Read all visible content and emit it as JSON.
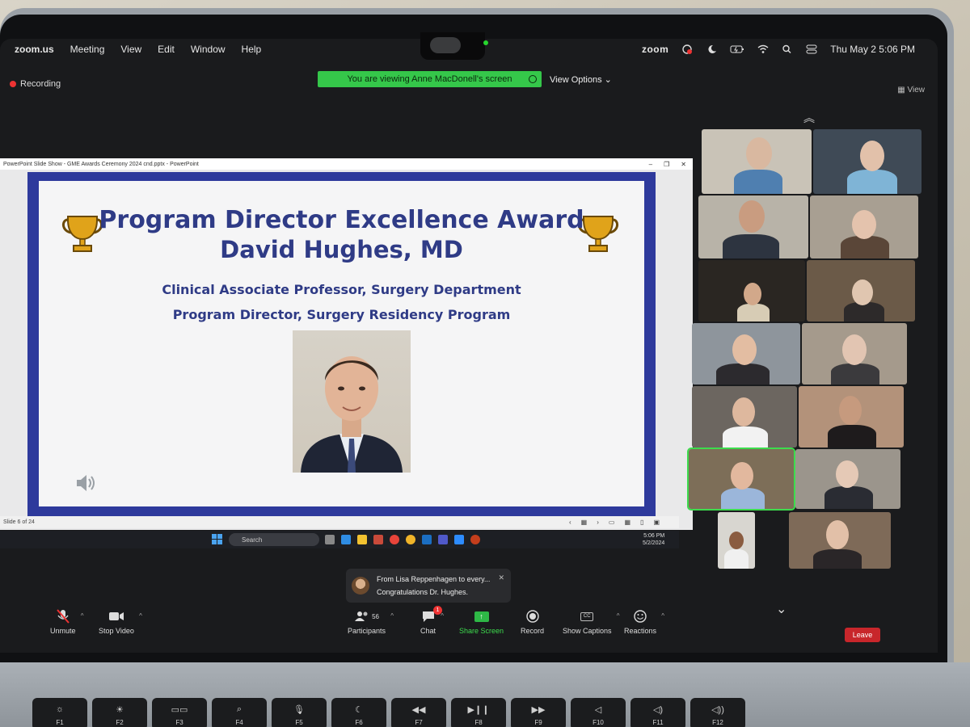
{
  "menubar": {
    "app_name": "zoom.us",
    "items": [
      "Meeting",
      "View",
      "Edit",
      "Window",
      "Help"
    ],
    "brand": "zoom",
    "datetime": "Thu May 2  5:06 PM"
  },
  "recording_label": "Recording",
  "share_banner": "You are viewing Anne MacDonell's screen",
  "view_options_label": "View Options",
  "view_label": "View",
  "ppt": {
    "window_title": "PowerPoint Slide Show  -  GME Awards Ceremony 2024 cnd.pptx - PowerPoint",
    "slide_title": "Program Director Excellence Award",
    "slide_name": "David Hughes, MD",
    "slide_sub1": "Clinical Associate Professor, Surgery Department",
    "slide_sub2": "Program Director, Surgery Residency Program",
    "status_slide": "Slide 6 of 24"
  },
  "taskbar": {
    "search_placeholder": "Search",
    "time": "5:06 PM",
    "date": "5/2/2024"
  },
  "chat_toast": {
    "from": "From Lisa Reppenhagen to every...",
    "message": "Congratulations Dr. Hughes."
  },
  "toolbar": {
    "unmute": "Unmute",
    "stop_video": "Stop Video",
    "participants": "Participants",
    "participants_count": "56",
    "chat": "Chat",
    "chat_badge": "1",
    "share_screen": "Share Screen",
    "record": "Record",
    "show_captions": "Show Captions",
    "captions_icon": "CC",
    "reactions": "Reactions",
    "leave": "Leave"
  },
  "keyboard": {
    "keys": [
      {
        "sym": "☼",
        "fn": "F1"
      },
      {
        "sym": "☀",
        "fn": "F2"
      },
      {
        "sym": "▭▭",
        "fn": "F3"
      },
      {
        "sym": "⌕",
        "fn": "F4"
      },
      {
        "sym": "🎙",
        "fn": "F5"
      },
      {
        "sym": "☾",
        "fn": "F6"
      },
      {
        "sym": "◀◀",
        "fn": "F7"
      },
      {
        "sym": "▶❙❙",
        "fn": "F8"
      },
      {
        "sym": "▶▶",
        "fn": "F9"
      },
      {
        "sym": "◁",
        "fn": "F10"
      },
      {
        "sym": "◁)",
        "fn": "F11"
      },
      {
        "sym": "◁))",
        "fn": "F12"
      }
    ]
  },
  "colors": {
    "slide_border": "#2e3a9c",
    "slide_text": "#2f3b86",
    "zoom_green": "#35c74a",
    "leave_red": "#c8262b"
  }
}
